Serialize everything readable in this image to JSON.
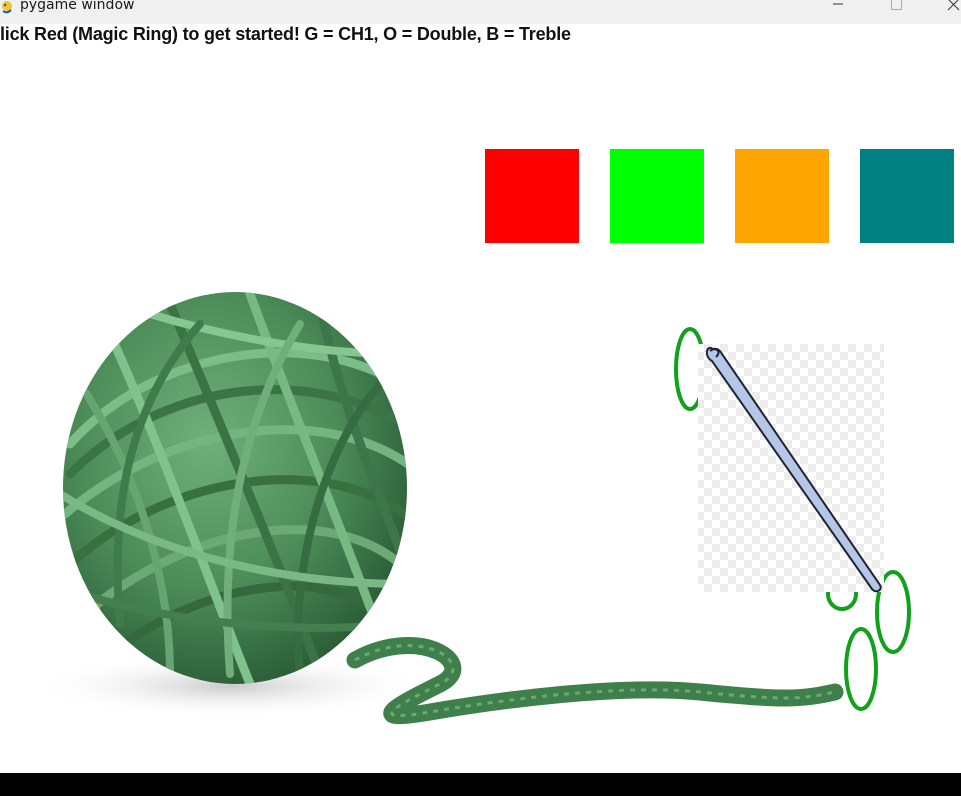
{
  "window": {
    "title": "pygame window",
    "icon": "pygame-snake-icon",
    "controls": [
      "minimize-icon",
      "maximize-icon",
      "close-icon"
    ]
  },
  "instruction": "lick Red (Magic Ring) to get started! G = CH1, O = Double, B = Treble",
  "swatches": [
    {
      "name": "red-swatch",
      "color": "#ff0000"
    },
    {
      "name": "green-swatch",
      "color": "#00ff00"
    },
    {
      "name": "orange-swatch",
      "color": "#ffa500"
    },
    {
      "name": "teal-swatch",
      "color": "#008080"
    }
  ],
  "colors": {
    "yarn": "#4f8f5c",
    "yarn_dark": "#2f6a3c",
    "stitch": "#11a11a",
    "hook": "#b6c6e6"
  }
}
